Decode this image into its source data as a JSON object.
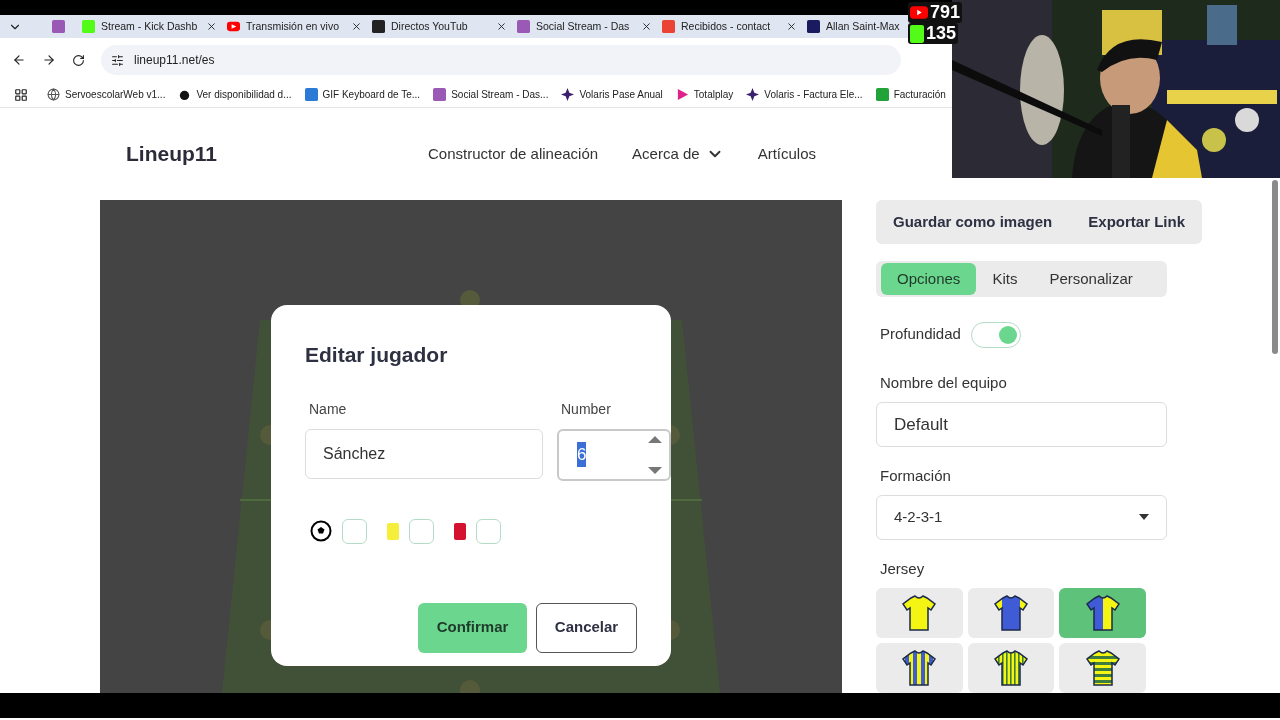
{
  "browser": {
    "tabs": [
      {
        "title": "Stream - Kick Dashb",
        "selected": false
      },
      {
        "title": "Transmisión en vivo",
        "selected": false
      },
      {
        "title": "Directos YouTub",
        "selected": false
      },
      {
        "title": "Social Stream - Das",
        "selected": false
      },
      {
        "title": "Recibidos - contact",
        "selected": false
      },
      {
        "title": "Allan Saint-Max",
        "selected": false
      }
    ],
    "url": "lineup11.net/es",
    "bookmarks": [
      {
        "title": "ServoescolarWeb v1..."
      },
      {
        "title": "Ver disponibilidad d..."
      },
      {
        "title": "GIF Keyboard de Te..."
      },
      {
        "title": "Social Stream - Das..."
      },
      {
        "title": "Volaris Pase Anual"
      },
      {
        "title": "Totalplay"
      },
      {
        "title": "Volaris - Factura Ele..."
      },
      {
        "title": "Facturación"
      }
    ]
  },
  "site": {
    "logo": "Lineup11",
    "nav": [
      {
        "label": "Constructor de alineación",
        "kind": "link"
      },
      {
        "label": "Acerca de",
        "kind": "dropdown"
      },
      {
        "label": "Artículos",
        "kind": "link"
      }
    ]
  },
  "dialog": {
    "title": "Editar jugador",
    "name_field": {
      "label": "Name",
      "value": "Sánchez"
    },
    "number_field": {
      "label": "Number",
      "value": "6",
      "text_selected": true
    },
    "markers": [
      {
        "kind": "goal",
        "checked": false
      },
      {
        "kind": "yellow_card",
        "checked": false
      },
      {
        "kind": "red_card",
        "checked": false
      }
    ],
    "confirm": "Confirmar",
    "cancel": "Cancelar"
  },
  "sidebar": {
    "actions": [
      "Guardar como imagen",
      "Exportar Link"
    ],
    "tabs": [
      {
        "label": "Opciones",
        "selected": true
      },
      {
        "label": "Kits",
        "selected": false
      },
      {
        "label": "Personalizar",
        "selected": false
      }
    ],
    "depth": {
      "label": "Profundidad",
      "on": true
    },
    "team_name": {
      "label": "Nombre del equipo",
      "value": "Default"
    },
    "formation": {
      "label": "Formación",
      "value": "4-2-3-1"
    },
    "jersey": {
      "label": "Jersey",
      "options": [
        {
          "kind": "solid",
          "selected": false
        },
        {
          "kind": "sleeves",
          "selected": false
        },
        {
          "kind": "halves",
          "selected": true
        },
        {
          "kind": "stripes",
          "selected": false
        },
        {
          "kind": "pinstripes",
          "selected": false
        },
        {
          "kind": "hoops",
          "selected": false
        }
      ]
    }
  },
  "stream_overlay": {
    "counters": [
      {
        "kind": "youtube",
        "value": "791"
      },
      {
        "kind": "kick",
        "value": "135"
      }
    ]
  }
}
